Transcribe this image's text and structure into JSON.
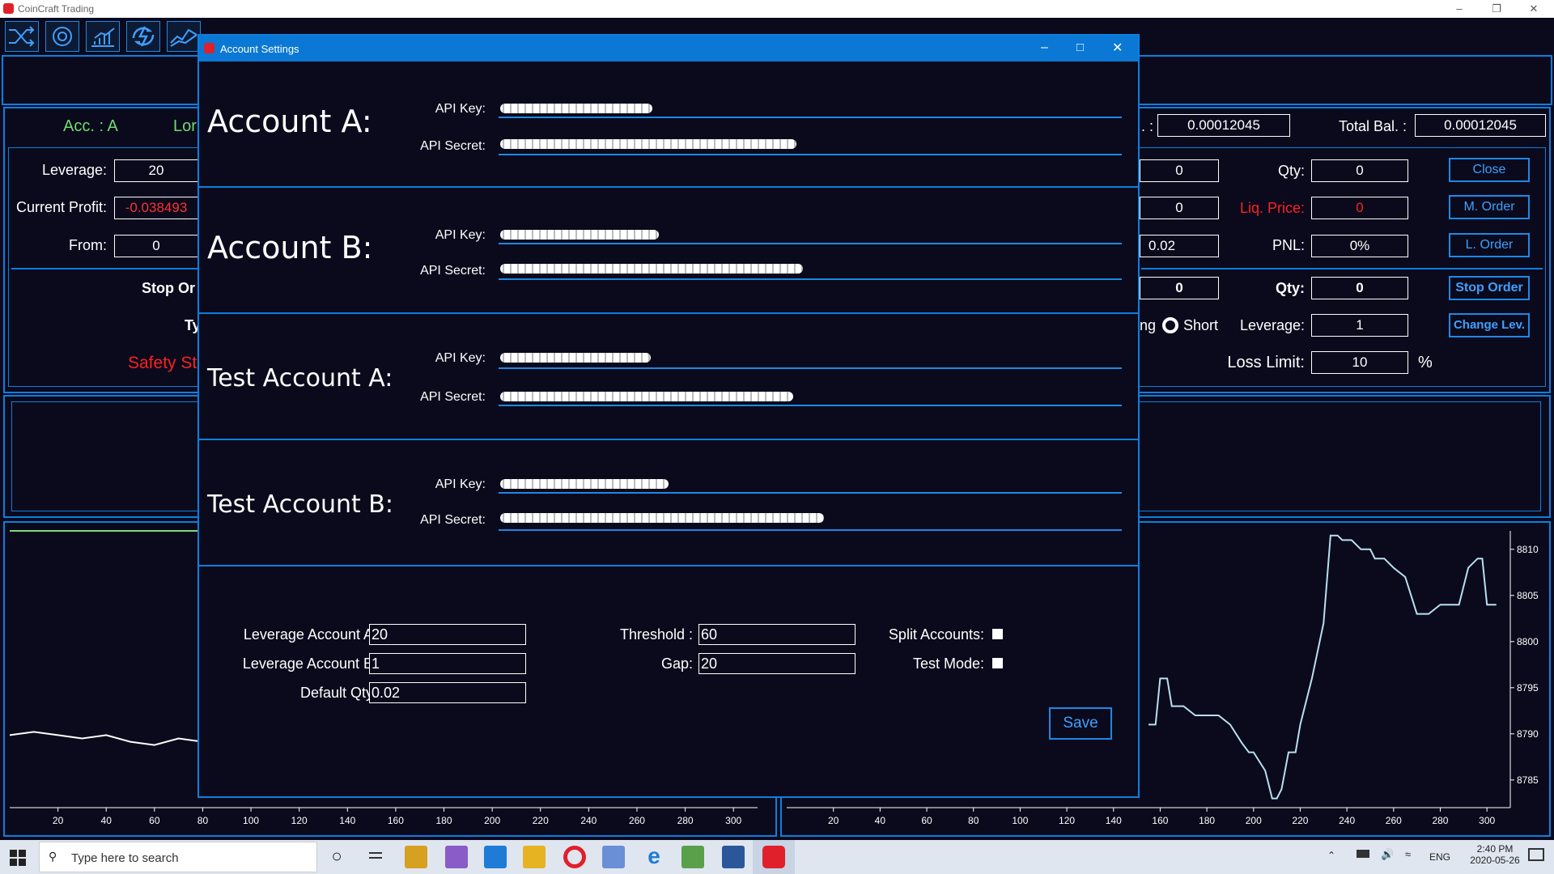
{
  "app": {
    "title": "CoinCraft Trading"
  },
  "main": {
    "acc_label": "Acc. : A",
    "long_partial": "Lor",
    "leverage_label": "Leverage:",
    "leverage_value": "20",
    "profit_label": "Current Profit:",
    "profit_value": "-0.038493",
    "from_label": "From:",
    "from_value": "0",
    "stop_order_partial": "Stop Or",
    "type_partial": "Ty",
    "safety_partial": "Safety St",
    "bal_partial": ". :",
    "bal_value": "0.00012045",
    "total_bal_label": "Total Bal. :",
    "total_bal_value": "0.00012045",
    "r1_box": "0",
    "r2_box": "0",
    "r3_box": "0.02",
    "r4_box": "0",
    "qty_label": "Qty:",
    "qty_value": "0",
    "liq_label": "Liq. Price:",
    "liq_value": "0",
    "pnl_label": "PNL:",
    "pnl_value": "0%",
    "qty2_label": "Qty:",
    "qty2_value": "0",
    "long_radio_partial": "ng",
    "short_label": "Short",
    "lev2_label": "Leverage:",
    "lev2_value": "1",
    "loss_label": "Loss Limit:",
    "loss_value": "10",
    "percent": "%",
    "btn_close": "Close",
    "btn_morder": "M. Order",
    "btn_lorder": "L. Order",
    "btn_stop": "Stop Order",
    "btn_change": "Change Lev."
  },
  "dialog": {
    "title": "Account Settings",
    "sections": [
      {
        "name": "Account A:"
      },
      {
        "name": "Account B:"
      },
      {
        "name": "Test Account A:"
      },
      {
        "name": "Test Account B:"
      }
    ],
    "api_key_label": "API Key:",
    "api_secret_label": "API Secret:",
    "settings": {
      "lev_a_label": "Leverage Account A:",
      "lev_a": "20",
      "lev_b_label": "Leverage Account B:",
      "lev_b": "1",
      "qty_label": "Default Qty:",
      "qty": "0.02",
      "threshold_label": "Threshold :",
      "threshold": "60",
      "gap_label": "Gap:",
      "gap": "20",
      "split_label": "Split Accounts:",
      "test_label": "Test Mode:",
      "save": "Save"
    }
  },
  "chart_data": [
    {
      "type": "line",
      "x_ticks": [
        20,
        40,
        60,
        80,
        100,
        120,
        140,
        160,
        180,
        200,
        220,
        240,
        260,
        280,
        300
      ],
      "series": [
        {
          "color": "#ffffff",
          "x": [
            0,
            10,
            20,
            30,
            40,
            50,
            60,
            70,
            80,
            90,
            100,
            110,
            120,
            130,
            140,
            150,
            160,
            170,
            180,
            190,
            200,
            210,
            220,
            230
          ],
          "y": [
            8781,
            8781.5,
            8781,
            8780.5,
            8781,
            8780,
            8779.5,
            8780.5,
            8780,
            8780.5,
            8780,
            8780.5,
            8780,
            8779.5,
            8780,
            8780.5,
            8780,
            8780,
            8779.5,
            8780,
            8780.5,
            8779.5,
            8780,
            8780.5
          ]
        }
      ]
    },
    {
      "type": "line",
      "x_ticks": [
        20,
        40,
        60,
        80,
        100,
        120,
        140,
        160,
        180,
        200,
        220,
        240,
        260,
        280,
        300
      ],
      "y_ticks": [
        8785,
        8790,
        8795,
        8800,
        8805,
        8810
      ],
      "ylim": [
        8782,
        8812
      ],
      "series": [
        {
          "color": "#b8e0ee",
          "x": [
            155,
            158,
            160,
            163,
            165,
            170,
            175,
            180,
            185,
            190,
            195,
            198,
            200,
            205,
            208,
            210,
            212,
            215,
            218,
            220,
            225,
            230,
            233,
            236,
            238,
            242,
            246,
            250,
            252,
            256,
            260,
            265,
            270,
            275,
            280,
            285,
            288,
            292,
            296,
            298,
            300,
            304
          ],
          "y": [
            8791,
            8791,
            8796,
            8796,
            8793,
            8793,
            8792,
            8792,
            8792,
            8791,
            8789,
            8788,
            8788,
            8786,
            8783,
            8783,
            8784,
            8788,
            8788,
            8791,
            8796,
            8802,
            8811.5,
            8811.5,
            8811,
            8811,
            8810,
            8810,
            8809,
            8809,
            8808,
            8807,
            8803,
            8803,
            8804,
            8804,
            8804,
            8808,
            8809,
            8809,
            8804,
            8804
          ]
        }
      ]
    }
  ]
}
